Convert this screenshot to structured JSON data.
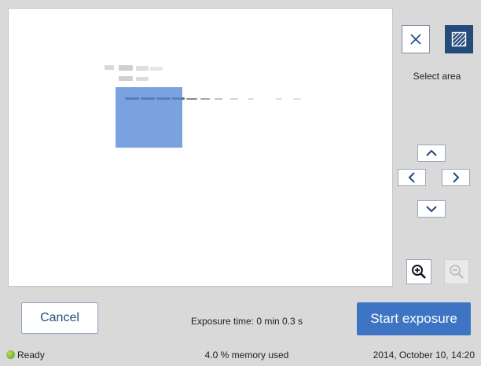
{
  "side_panel": {
    "select_area_label": "Select area"
  },
  "icons": {
    "clear_selection": "close-icon",
    "select_area": "hatched-area-icon",
    "pan_up": "chevron-up-icon",
    "pan_left": "chevron-left-icon",
    "pan_right": "chevron-right-icon",
    "pan_down": "chevron-down-icon",
    "zoom_in": "zoom-in-icon",
    "zoom_out": "zoom-out-icon",
    "ready_indicator": "status-dot-icon"
  },
  "footer": {
    "cancel_label": "Cancel",
    "exposure_time": "Exposure time: 0 min 0.3 s",
    "start_label": "Start exposure",
    "status_text": "Ready",
    "memory_text": "4.0 % memory used",
    "datetime": "2014, October 10, 14:20"
  },
  "colors": {
    "accent": "#3d74c4",
    "active_toggle": "#254a7c",
    "selection_overlay": "#5488d6",
    "ready_green": "#6fb325"
  }
}
